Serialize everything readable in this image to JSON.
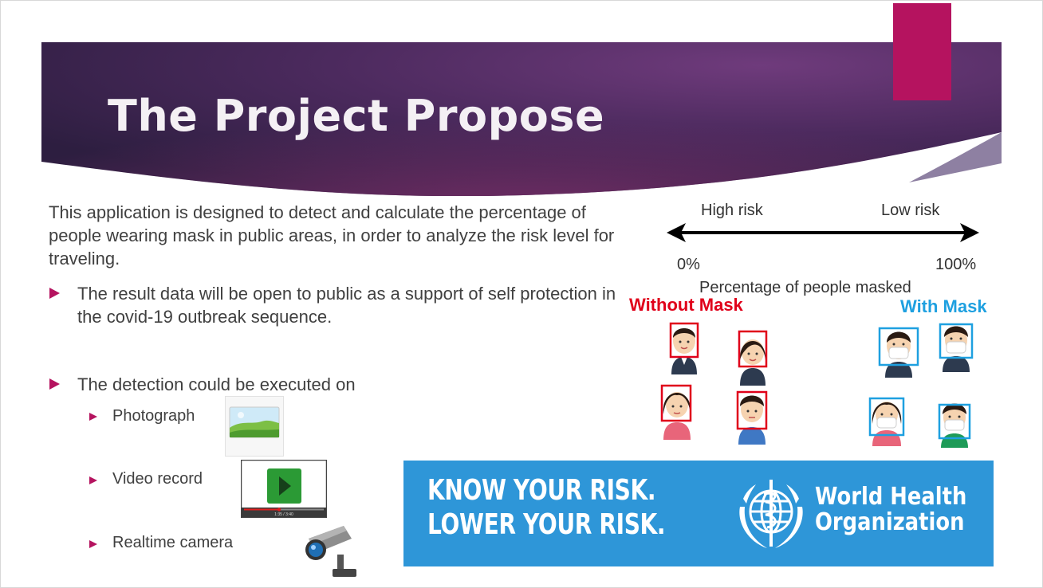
{
  "slide": {
    "title": "The Project Propose",
    "intro": "This application is designed to detect and calculate the percentage of people wearing mask in public areas, in order to analyze the risk level for traveling.",
    "bullets": [
      "The result data will be open to public as a support of self protection in the covid-19 outbreak sequence.",
      "The detection could be executed on"
    ],
    "sub_bullets": [
      "Photograph",
      "Video record",
      "Realtime camera"
    ]
  },
  "risk_scale": {
    "left_label": "High risk",
    "right_label": "Low risk",
    "min_label": "0%",
    "max_label": "100%",
    "axis_label": "Percentage of people masked"
  },
  "mask_groups": {
    "without": "Without Mask",
    "with": "With Mask"
  },
  "who_banner": {
    "slogan_line1": "KNOW YOUR RISK.",
    "slogan_line2": "LOWER YOUR RISK.",
    "org_line1": "World Health",
    "org_line2": "Organization"
  },
  "icons": {
    "photo": "photograph-icon",
    "video": "video-player-icon",
    "camera": "security-camera-icon",
    "who": "who-emblem-icon"
  },
  "video_time": "1:35 / 3:40",
  "colors": {
    "accent": "#b5135f",
    "without_mask": "#e0001a",
    "with_mask": "#1ea0e0",
    "who_blue": "#2e96d8"
  }
}
